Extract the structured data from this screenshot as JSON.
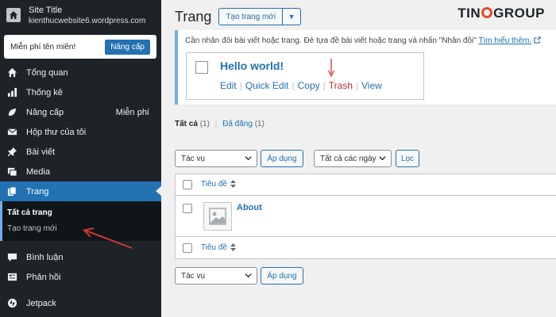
{
  "sidebar": {
    "site_title": "Site Title",
    "site_url": "kienthucwebsite6.wordpress.com",
    "domain_text": "Miễn phí tên miền!",
    "upgrade_label": "Nâng cấp",
    "items": [
      {
        "label": "Tổng quan",
        "icon": "dashboard-icon"
      },
      {
        "label": "Thống kê",
        "icon": "stats-icon"
      },
      {
        "label": "Nâng cấp",
        "icon": "upgrades-icon",
        "extra": "Miễn phí"
      },
      {
        "label": "Hộp thư của tôi",
        "icon": "mail-icon"
      },
      {
        "label": "Bài viết",
        "icon": "pin-icon"
      },
      {
        "label": "Media",
        "icon": "media-icon"
      },
      {
        "label": "Trang",
        "icon": "pages-icon"
      },
      {
        "label": "Bình luận",
        "icon": "comments-icon"
      },
      {
        "label": "Phản hồi",
        "icon": "feedback-icon"
      },
      {
        "label": "Jetpack",
        "icon": "jetpack-icon"
      }
    ],
    "submenu": [
      {
        "label": "Tất cả trang"
      },
      {
        "label": "Tạo trang mới"
      }
    ]
  },
  "header": {
    "page_title": "Trang",
    "add_new_label": "Tạo trang mới",
    "brand": {
      "before": "TIN",
      "after": "GROUP"
    }
  },
  "notice": {
    "text": "Cần nhân đôi bài viết hoặc trang. Đè tựa đề bài viết hoặc trang và nhấn \"Nhân đôi\"",
    "link": "Tìm hiểu thêm.",
    "preview_title": "Hello world!",
    "actions": [
      "Edit",
      "Quick Edit",
      "Copy",
      "Trash",
      "View"
    ]
  },
  "filters": {
    "all_label": "Tất cả",
    "all_count": "(1)",
    "published_label": "Đã đăng",
    "published_count": "(1)"
  },
  "toolbar": {
    "bulk_action": "Tác vụ",
    "apply_label": "Áp dụng",
    "date_filter": "Tất cả các ngày",
    "filter_label": "Lọc"
  },
  "table": {
    "column_title": "Tiêu đề",
    "rows": [
      {
        "title": "About"
      }
    ]
  },
  "colors": {
    "sidebar_bg": "#1d2327",
    "accent": "#2271b1",
    "trash": "#b32d2e",
    "annotation_arrow": "#d63638",
    "brand_o": "#e04f24"
  }
}
